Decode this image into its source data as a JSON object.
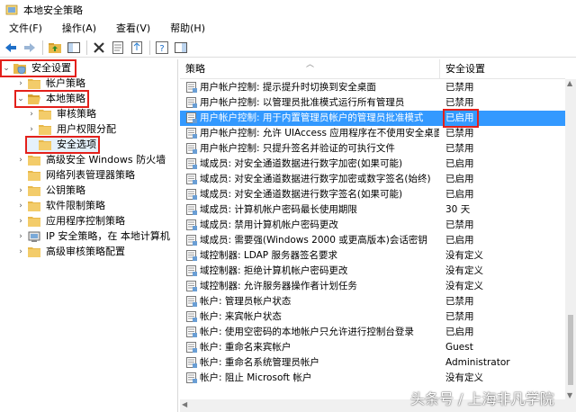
{
  "window": {
    "title": "本地安全策略"
  },
  "menu": [
    "文件(F)",
    "操作(A)",
    "查看(V)",
    "帮助(H)"
  ],
  "colors": {
    "selection": "#3399ff",
    "highlight_box": "#e3201b",
    "folder": "#e8b84a"
  },
  "tree": [
    {
      "label": "安全设置",
      "level": 0,
      "expander": "down",
      "icon": "shield-folder-icon",
      "highlighted": true
    },
    {
      "label": "帐户策略",
      "level": 1,
      "expander": "right",
      "icon": "folder-icon"
    },
    {
      "label": "本地策略",
      "level": 1,
      "expander": "down",
      "icon": "folder-open-icon",
      "highlighted": true
    },
    {
      "label": "审核策略",
      "level": 2,
      "expander": "right",
      "icon": "folder-icon"
    },
    {
      "label": "用户权限分配",
      "level": 2,
      "expander": "right",
      "icon": "folder-icon"
    },
    {
      "label": "安全选项",
      "level": 2,
      "expander": "",
      "icon": "folder-icon",
      "highlighted": true,
      "selected": true
    },
    {
      "label": "高级安全 Windows 防火墙",
      "level": 1,
      "expander": "right",
      "icon": "folder-icon"
    },
    {
      "label": "网络列表管理器策略",
      "level": 1,
      "expander": "",
      "icon": "folder-icon"
    },
    {
      "label": "公钥策略",
      "level": 1,
      "expander": "right",
      "icon": "folder-icon"
    },
    {
      "label": "软件限制策略",
      "level": 1,
      "expander": "right",
      "icon": "folder-icon"
    },
    {
      "label": "应用程序控制策略",
      "level": 1,
      "expander": "right",
      "icon": "folder-icon"
    },
    {
      "label": "IP 安全策略，在 本地计算机",
      "level": 1,
      "expander": "right",
      "icon": "ip-security-icon"
    },
    {
      "label": "高级审核策略配置",
      "level": 1,
      "expander": "right",
      "icon": "folder-icon"
    }
  ],
  "table": {
    "columns": [
      "策略",
      "安全设置"
    ],
    "rows": [
      {
        "policy": "用户帐户控制: 提示提升时切换到安全桌面",
        "setting": "已禁用"
      },
      {
        "policy": "用户帐户控制: 以管理员批准模式运行所有管理员",
        "setting": "已禁用"
      },
      {
        "policy": "用户帐户控制: 用于内置管理员帐户的管理员批准模式",
        "setting": "已启用",
        "selected": true,
        "highlighted": true
      },
      {
        "policy": "用户帐户控制: 允许 UIAccess 应用程序在不使用安全桌面...",
        "setting": "已禁用"
      },
      {
        "policy": "用户帐户控制: 只提升签名并验证的可执行文件",
        "setting": "已禁用"
      },
      {
        "policy": "域成员: 对安全通道数据进行数字加密(如果可能)",
        "setting": "已启用"
      },
      {
        "policy": "域成员: 对安全通道数据进行数字加密或数字签名(始终)",
        "setting": "已启用"
      },
      {
        "policy": "域成员: 对安全通道数据进行数字签名(如果可能)",
        "setting": "已启用"
      },
      {
        "policy": "域成员: 计算机帐户密码最长使用期限",
        "setting": "30 天"
      },
      {
        "policy": "域成员: 禁用计算机帐户密码更改",
        "setting": "已禁用"
      },
      {
        "policy": "域成员: 需要强(Windows 2000 或更高版本)会话密钥",
        "setting": "已启用"
      },
      {
        "policy": "域控制器: LDAP 服务器签名要求",
        "setting": "没有定义"
      },
      {
        "policy": "域控制器: 拒绝计算机帐户密码更改",
        "setting": "没有定义"
      },
      {
        "policy": "域控制器: 允许服务器操作者计划任务",
        "setting": "没有定义"
      },
      {
        "policy": "帐户: 管理员帐户状态",
        "setting": "已禁用"
      },
      {
        "policy": "帐户: 来宾帐户状态",
        "setting": "已禁用"
      },
      {
        "policy": "帐户: 使用空密码的本地帐户只允许进行控制台登录",
        "setting": "已启用"
      },
      {
        "policy": "帐户: 重命名来宾帐户",
        "setting": "Guest"
      },
      {
        "policy": "帐户: 重命名系统管理员帐户",
        "setting": "Administrator"
      },
      {
        "policy": "帐户: 阻止 Microsoft 帐户",
        "setting": "没有定义"
      }
    ]
  },
  "watermark": "头条号 / 上海非凡学院"
}
